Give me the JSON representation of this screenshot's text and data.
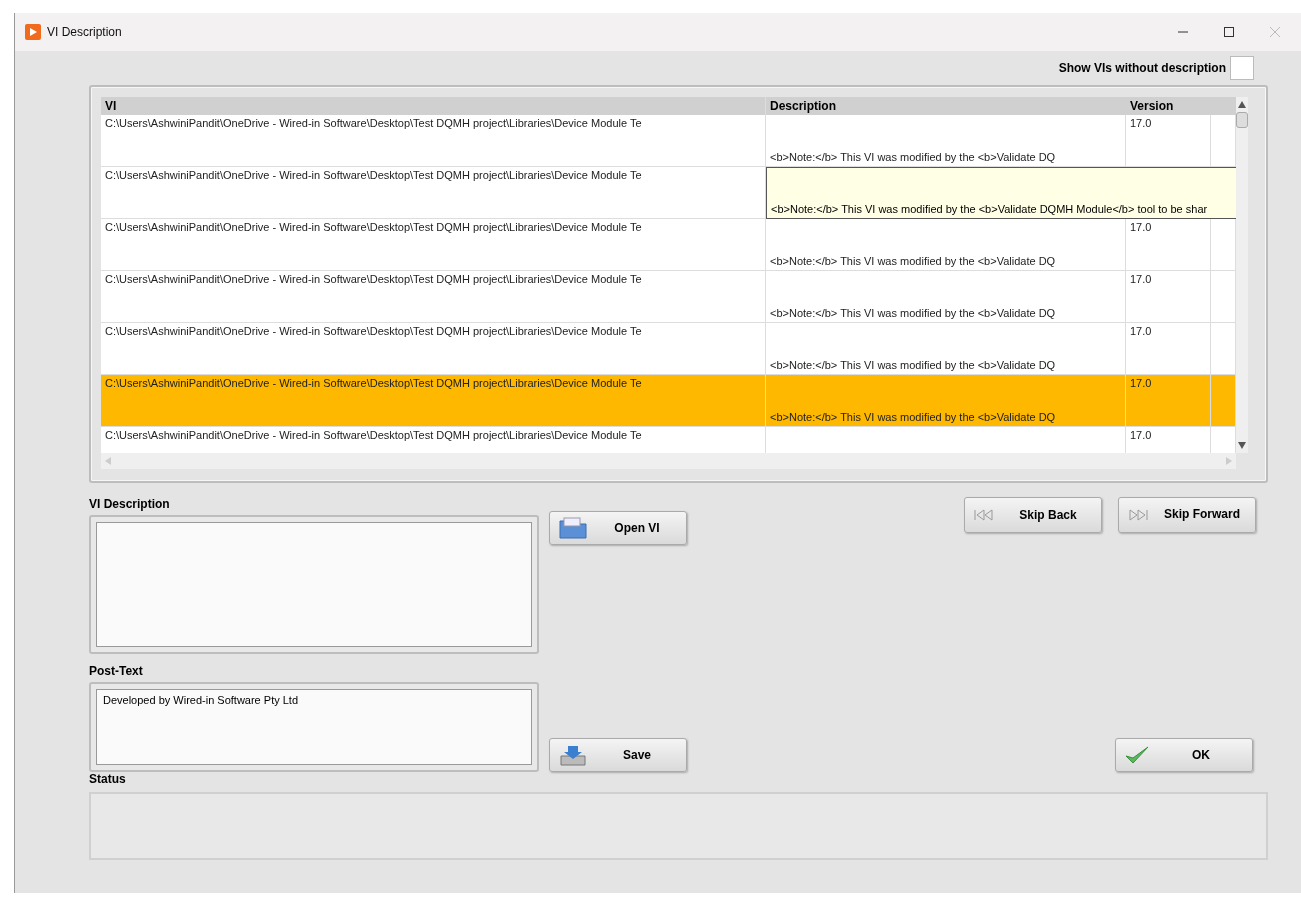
{
  "window": {
    "title": "VI Description"
  },
  "show_without_description": {
    "label": "Show VIs without description",
    "checked": false
  },
  "table": {
    "columns": [
      "VI",
      "Description",
      "Version"
    ],
    "rows": [
      {
        "vi": "C:\\Users\\AshwiniPandit\\OneDrive - Wired-in Software\\Desktop\\Test DQMH project\\Libraries\\Device Module Te",
        "description": "<b>Note:</b> This VI was modified by the <b>Validate DQ",
        "version": "17.0",
        "selected": false
      },
      {
        "vi": "C:\\Users\\AshwiniPandit\\OneDrive - Wired-in Software\\Desktop\\Test DQMH project\\Libraries\\Device Module Te",
        "tooltip": "<b>Note:</b> This VI was modified by the <b>Validate DQMH Module</b> tool to be shar",
        "selected": false
      },
      {
        "vi": "C:\\Users\\AshwiniPandit\\OneDrive - Wired-in Software\\Desktop\\Test DQMH project\\Libraries\\Device Module Te",
        "description": "<b>Note:</b> This VI was modified by the <b>Validate DQ",
        "version": "17.0",
        "selected": false
      },
      {
        "vi": "C:\\Users\\AshwiniPandit\\OneDrive - Wired-in Software\\Desktop\\Test DQMH project\\Libraries\\Device Module Te",
        "description": "<b>Note:</b> This VI was modified by the <b>Validate DQ",
        "version": "17.0",
        "selected": false
      },
      {
        "vi": "C:\\Users\\AshwiniPandit\\OneDrive - Wired-in Software\\Desktop\\Test DQMH project\\Libraries\\Device Module Te",
        "description": "<b>Note:</b> This VI was modified by the <b>Validate DQ",
        "version": "17.0",
        "selected": false
      },
      {
        "vi": "C:\\Users\\AshwiniPandit\\OneDrive - Wired-in Software\\Desktop\\Test DQMH project\\Libraries\\Device Module Te",
        "description": "<b>Note:</b> This VI was modified by the <b>Validate DQ",
        "version": "17.0",
        "selected": true
      },
      {
        "vi": "C:\\Users\\AshwiniPandit\\OneDrive - Wired-in Software\\Desktop\\Test DQMH project\\Libraries\\Device Module Te",
        "version": "17.0",
        "selected": false
      }
    ]
  },
  "vi_description": {
    "label": "VI Description"
  },
  "post_text": {
    "label": "Post-Text",
    "value": "Developed by Wired-in Software Pty Ltd"
  },
  "status": {
    "label": "Status"
  },
  "buttons": {
    "open_vi": "Open VI",
    "save": "Save",
    "skip_back": "Skip Back",
    "skip_forward": "Skip Forward",
    "ok": "OK"
  }
}
